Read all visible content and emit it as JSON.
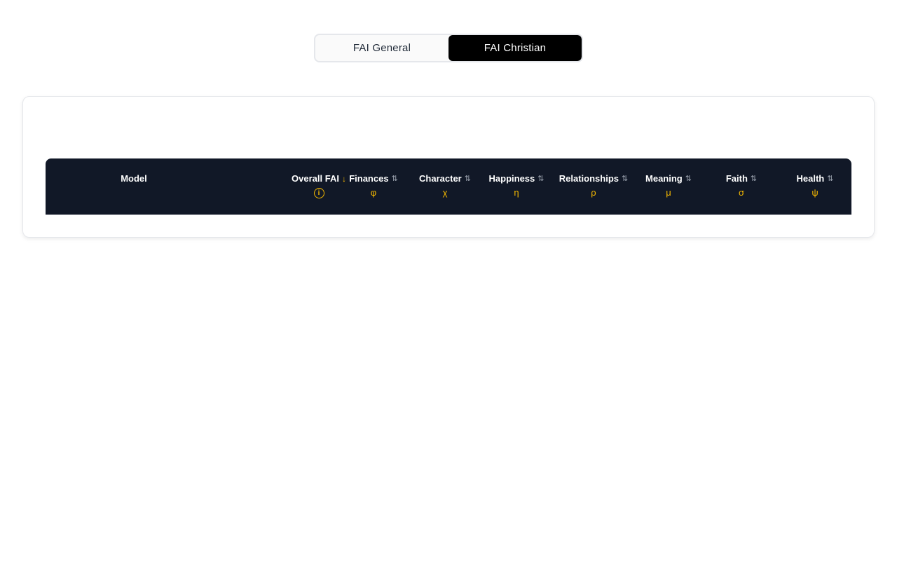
{
  "toggle": {
    "options": [
      {
        "label": "FAI General",
        "active": false
      },
      {
        "label": "FAI Christian",
        "active": true
      }
    ]
  },
  "table": {
    "model_header": "Model",
    "columns": [
      {
        "label": "Overall FAI",
        "sort": "desc",
        "icon": "info-icon"
      },
      {
        "label": "Finances",
        "symbol": "φ",
        "sort": "none"
      },
      {
        "label": "Character",
        "symbol": "χ",
        "sort": "none"
      },
      {
        "label": "Happiness",
        "symbol": "η",
        "sort": "none"
      },
      {
        "label": "Relationships",
        "symbol": "ρ",
        "sort": "none"
      },
      {
        "label": "Meaning",
        "symbol": "μ",
        "sort": "none"
      },
      {
        "label": "Faith",
        "symbol": "σ",
        "sort": "none"
      },
      {
        "label": "Health",
        "symbol": "ψ",
        "sort": "none"
      }
    ],
    "sort_glyph_active": "↓",
    "sort_glyph_inactive": "⇅",
    "info_glyph": "i"
  },
  "colors": {
    "header_bg": "#111827",
    "accent": "#f5b800",
    "toggle_active_bg": "#000000"
  }
}
